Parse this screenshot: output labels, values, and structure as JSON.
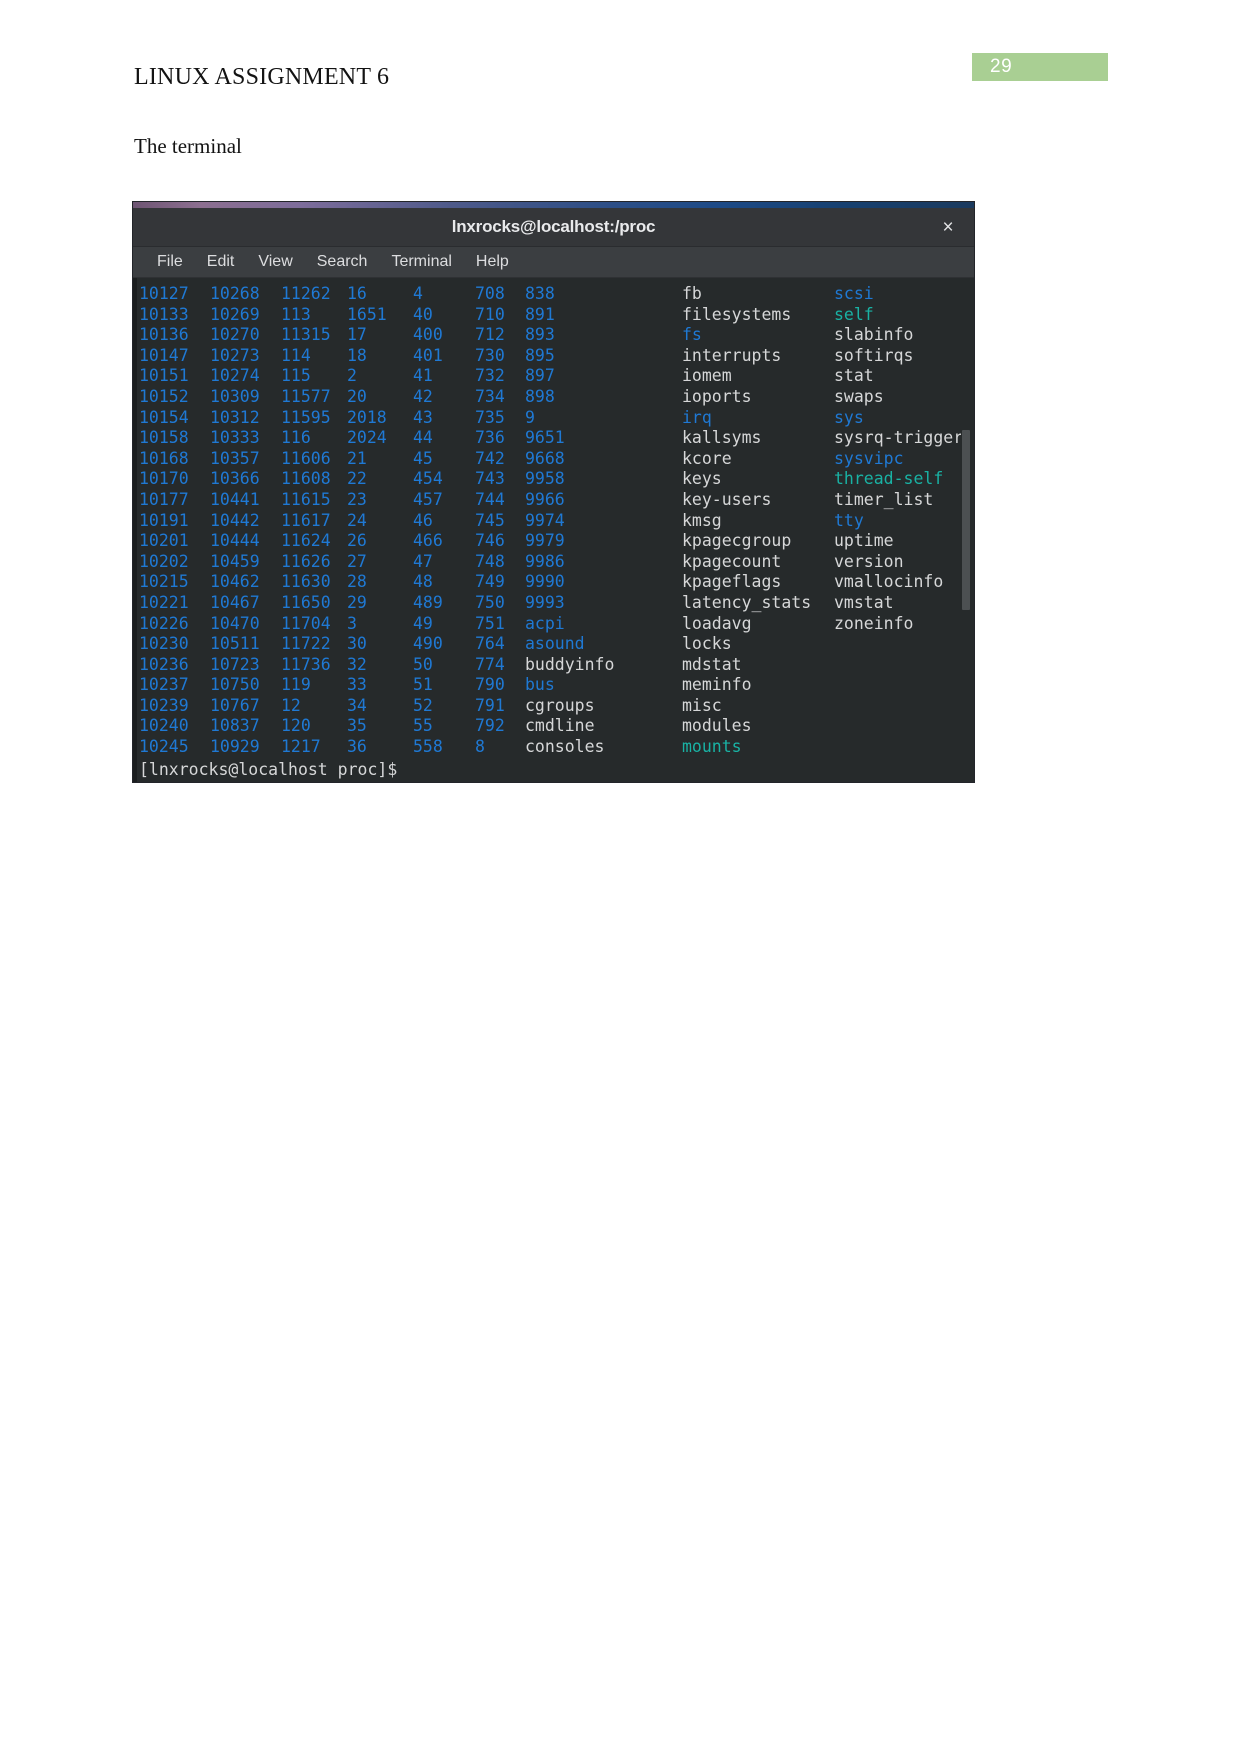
{
  "document": {
    "title": "LINUX ASSIGNMENT 6",
    "subtitle": "The terminal",
    "page_number": "29",
    "badge_color": "#a9cf93"
  },
  "terminal": {
    "window_title": "lnxrocks@localhost:/proc",
    "close_icon": "×",
    "menu": [
      {
        "label": "File"
      },
      {
        "label": "Edit"
      },
      {
        "label": "View"
      },
      {
        "label": "Search"
      },
      {
        "label": "Terminal"
      },
      {
        "label": "Help"
      }
    ],
    "prompt": "[lnxrocks@localhost proc]$",
    "colors": {
      "directory": "#1f79d4",
      "file": "#d6d7d8",
      "symlink": "#19b2a4",
      "background": "#262a2b",
      "titlebar": "#343639",
      "menubar": "#3b3e41"
    },
    "listing_rows": [
      [
        {
          "t": "10127",
          "k": "dir"
        },
        {
          "t": "10268",
          "k": "dir"
        },
        {
          "t": "11262",
          "k": "dir"
        },
        {
          "t": "16",
          "k": "dir"
        },
        {
          "t": "4",
          "k": "dir"
        },
        {
          "t": "708",
          "k": "dir"
        },
        {
          "t": "838",
          "k": "dir"
        },
        {
          "t": "fb",
          "k": "file"
        },
        {
          "t": "scsi",
          "k": "dir"
        }
      ],
      [
        {
          "t": "10133",
          "k": "dir"
        },
        {
          "t": "10269",
          "k": "dir"
        },
        {
          "t": "113",
          "k": "dir"
        },
        {
          "t": "1651",
          "k": "dir"
        },
        {
          "t": "40",
          "k": "dir"
        },
        {
          "t": "710",
          "k": "dir"
        },
        {
          "t": "891",
          "k": "dir"
        },
        {
          "t": "filesystems",
          "k": "file"
        },
        {
          "t": "self",
          "k": "link"
        }
      ],
      [
        {
          "t": "10136",
          "k": "dir"
        },
        {
          "t": "10270",
          "k": "dir"
        },
        {
          "t": "11315",
          "k": "dir"
        },
        {
          "t": "17",
          "k": "dir"
        },
        {
          "t": "400",
          "k": "dir"
        },
        {
          "t": "712",
          "k": "dir"
        },
        {
          "t": "893",
          "k": "dir"
        },
        {
          "t": "fs",
          "k": "dir"
        },
        {
          "t": "slabinfo",
          "k": "file"
        }
      ],
      [
        {
          "t": "10147",
          "k": "dir"
        },
        {
          "t": "10273",
          "k": "dir"
        },
        {
          "t": "114",
          "k": "dir"
        },
        {
          "t": "18",
          "k": "dir"
        },
        {
          "t": "401",
          "k": "dir"
        },
        {
          "t": "730",
          "k": "dir"
        },
        {
          "t": "895",
          "k": "dir"
        },
        {
          "t": "interrupts",
          "k": "file"
        },
        {
          "t": "softirqs",
          "k": "file"
        }
      ],
      [
        {
          "t": "10151",
          "k": "dir"
        },
        {
          "t": "10274",
          "k": "dir"
        },
        {
          "t": "115",
          "k": "dir"
        },
        {
          "t": "2",
          "k": "dir"
        },
        {
          "t": "41",
          "k": "dir"
        },
        {
          "t": "732",
          "k": "dir"
        },
        {
          "t": "897",
          "k": "dir"
        },
        {
          "t": "iomem",
          "k": "file"
        },
        {
          "t": "stat",
          "k": "file"
        }
      ],
      [
        {
          "t": "10152",
          "k": "dir"
        },
        {
          "t": "10309",
          "k": "dir"
        },
        {
          "t": "11577",
          "k": "dir"
        },
        {
          "t": "20",
          "k": "dir"
        },
        {
          "t": "42",
          "k": "dir"
        },
        {
          "t": "734",
          "k": "dir"
        },
        {
          "t": "898",
          "k": "dir"
        },
        {
          "t": "ioports",
          "k": "file"
        },
        {
          "t": "swaps",
          "k": "file"
        }
      ],
      [
        {
          "t": "10154",
          "k": "dir"
        },
        {
          "t": "10312",
          "k": "dir"
        },
        {
          "t": "11595",
          "k": "dir"
        },
        {
          "t": "2018",
          "k": "dir"
        },
        {
          "t": "43",
          "k": "dir"
        },
        {
          "t": "735",
          "k": "dir"
        },
        {
          "t": "9",
          "k": "dir"
        },
        {
          "t": "irq",
          "k": "dir"
        },
        {
          "t": "sys",
          "k": "dir"
        }
      ],
      [
        {
          "t": "10158",
          "k": "dir"
        },
        {
          "t": "10333",
          "k": "dir"
        },
        {
          "t": "116",
          "k": "dir"
        },
        {
          "t": "2024",
          "k": "dir"
        },
        {
          "t": "44",
          "k": "dir"
        },
        {
          "t": "736",
          "k": "dir"
        },
        {
          "t": "9651",
          "k": "dir"
        },
        {
          "t": "kallsyms",
          "k": "file"
        },
        {
          "t": "sysrq-trigger",
          "k": "file"
        }
      ],
      [
        {
          "t": "10168",
          "k": "dir"
        },
        {
          "t": "10357",
          "k": "dir"
        },
        {
          "t": "11606",
          "k": "dir"
        },
        {
          "t": "21",
          "k": "dir"
        },
        {
          "t": "45",
          "k": "dir"
        },
        {
          "t": "742",
          "k": "dir"
        },
        {
          "t": "9668",
          "k": "dir"
        },
        {
          "t": "kcore",
          "k": "file"
        },
        {
          "t": "sysvipc",
          "k": "dir"
        }
      ],
      [
        {
          "t": "10170",
          "k": "dir"
        },
        {
          "t": "10366",
          "k": "dir"
        },
        {
          "t": "11608",
          "k": "dir"
        },
        {
          "t": "22",
          "k": "dir"
        },
        {
          "t": "454",
          "k": "dir"
        },
        {
          "t": "743",
          "k": "dir"
        },
        {
          "t": "9958",
          "k": "dir"
        },
        {
          "t": "keys",
          "k": "file"
        },
        {
          "t": "thread-self",
          "k": "link"
        }
      ],
      [
        {
          "t": "10177",
          "k": "dir"
        },
        {
          "t": "10441",
          "k": "dir"
        },
        {
          "t": "11615",
          "k": "dir"
        },
        {
          "t": "23",
          "k": "dir"
        },
        {
          "t": "457",
          "k": "dir"
        },
        {
          "t": "744",
          "k": "dir"
        },
        {
          "t": "9966",
          "k": "dir"
        },
        {
          "t": "key-users",
          "k": "file"
        },
        {
          "t": "timer_list",
          "k": "file"
        }
      ],
      [
        {
          "t": "10191",
          "k": "dir"
        },
        {
          "t": "10442",
          "k": "dir"
        },
        {
          "t": "11617",
          "k": "dir"
        },
        {
          "t": "24",
          "k": "dir"
        },
        {
          "t": "46",
          "k": "dir"
        },
        {
          "t": "745",
          "k": "dir"
        },
        {
          "t": "9974",
          "k": "dir"
        },
        {
          "t": "kmsg",
          "k": "file"
        },
        {
          "t": "tty",
          "k": "dir"
        }
      ],
      [
        {
          "t": "10201",
          "k": "dir"
        },
        {
          "t": "10444",
          "k": "dir"
        },
        {
          "t": "11624",
          "k": "dir"
        },
        {
          "t": "26",
          "k": "dir"
        },
        {
          "t": "466",
          "k": "dir"
        },
        {
          "t": "746",
          "k": "dir"
        },
        {
          "t": "9979",
          "k": "dir"
        },
        {
          "t": "kpagecgroup",
          "k": "file"
        },
        {
          "t": "uptime",
          "k": "file"
        }
      ],
      [
        {
          "t": "10202",
          "k": "dir"
        },
        {
          "t": "10459",
          "k": "dir"
        },
        {
          "t": "11626",
          "k": "dir"
        },
        {
          "t": "27",
          "k": "dir"
        },
        {
          "t": "47",
          "k": "dir"
        },
        {
          "t": "748",
          "k": "dir"
        },
        {
          "t": "9986",
          "k": "dir"
        },
        {
          "t": "kpagecount",
          "k": "file"
        },
        {
          "t": "version",
          "k": "file"
        }
      ],
      [
        {
          "t": "10215",
          "k": "dir"
        },
        {
          "t": "10462",
          "k": "dir"
        },
        {
          "t": "11630",
          "k": "dir"
        },
        {
          "t": "28",
          "k": "dir"
        },
        {
          "t": "48",
          "k": "dir"
        },
        {
          "t": "749",
          "k": "dir"
        },
        {
          "t": "9990",
          "k": "dir"
        },
        {
          "t": "kpageflags",
          "k": "file"
        },
        {
          "t": "vmallocinfo",
          "k": "file"
        }
      ],
      [
        {
          "t": "10221",
          "k": "dir"
        },
        {
          "t": "10467",
          "k": "dir"
        },
        {
          "t": "11650",
          "k": "dir"
        },
        {
          "t": "29",
          "k": "dir"
        },
        {
          "t": "489",
          "k": "dir"
        },
        {
          "t": "750",
          "k": "dir"
        },
        {
          "t": "9993",
          "k": "dir"
        },
        {
          "t": "latency_stats",
          "k": "file"
        },
        {
          "t": "vmstat",
          "k": "file"
        }
      ],
      [
        {
          "t": "10226",
          "k": "dir"
        },
        {
          "t": "10470",
          "k": "dir"
        },
        {
          "t": "11704",
          "k": "dir"
        },
        {
          "t": "3",
          "k": "dir"
        },
        {
          "t": "49",
          "k": "dir"
        },
        {
          "t": "751",
          "k": "dir"
        },
        {
          "t": "acpi",
          "k": "dir"
        },
        {
          "t": "loadavg",
          "k": "file"
        },
        {
          "t": "zoneinfo",
          "k": "file"
        }
      ],
      [
        {
          "t": "10230",
          "k": "dir"
        },
        {
          "t": "10511",
          "k": "dir"
        },
        {
          "t": "11722",
          "k": "dir"
        },
        {
          "t": "30",
          "k": "dir"
        },
        {
          "t": "490",
          "k": "dir"
        },
        {
          "t": "764",
          "k": "dir"
        },
        {
          "t": "asound",
          "k": "dir"
        },
        {
          "t": "locks",
          "k": "file"
        },
        {
          "t": "",
          "k": "file"
        }
      ],
      [
        {
          "t": "10236",
          "k": "dir"
        },
        {
          "t": "10723",
          "k": "dir"
        },
        {
          "t": "11736",
          "k": "dir"
        },
        {
          "t": "32",
          "k": "dir"
        },
        {
          "t": "50",
          "k": "dir"
        },
        {
          "t": "774",
          "k": "dir"
        },
        {
          "t": "buddyinfo",
          "k": "file"
        },
        {
          "t": "mdstat",
          "k": "file"
        },
        {
          "t": "",
          "k": "file"
        }
      ],
      [
        {
          "t": "10237",
          "k": "dir"
        },
        {
          "t": "10750",
          "k": "dir"
        },
        {
          "t": "119",
          "k": "dir"
        },
        {
          "t": "33",
          "k": "dir"
        },
        {
          "t": "51",
          "k": "dir"
        },
        {
          "t": "790",
          "k": "dir"
        },
        {
          "t": "bus",
          "k": "dir"
        },
        {
          "t": "meminfo",
          "k": "file"
        },
        {
          "t": "",
          "k": "file"
        }
      ],
      [
        {
          "t": "10239",
          "k": "dir"
        },
        {
          "t": "10767",
          "k": "dir"
        },
        {
          "t": "12",
          "k": "dir"
        },
        {
          "t": "34",
          "k": "dir"
        },
        {
          "t": "52",
          "k": "dir"
        },
        {
          "t": "791",
          "k": "dir"
        },
        {
          "t": "cgroups",
          "k": "file"
        },
        {
          "t": "misc",
          "k": "file"
        },
        {
          "t": "",
          "k": "file"
        }
      ],
      [
        {
          "t": "10240",
          "k": "dir"
        },
        {
          "t": "10837",
          "k": "dir"
        },
        {
          "t": "120",
          "k": "dir"
        },
        {
          "t": "35",
          "k": "dir"
        },
        {
          "t": "55",
          "k": "dir"
        },
        {
          "t": "792",
          "k": "dir"
        },
        {
          "t": "cmdline",
          "k": "file"
        },
        {
          "t": "modules",
          "k": "file"
        },
        {
          "t": "",
          "k": "file"
        }
      ],
      [
        {
          "t": "10245",
          "k": "dir"
        },
        {
          "t": "10929",
          "k": "dir"
        },
        {
          "t": "1217",
          "k": "dir"
        },
        {
          "t": "36",
          "k": "dir"
        },
        {
          "t": "558",
          "k": "dir"
        },
        {
          "t": "8",
          "k": "dir"
        },
        {
          "t": "consoles",
          "k": "file"
        },
        {
          "t": "mounts",
          "k": "link"
        },
        {
          "t": "",
          "k": "file"
        }
      ]
    ]
  }
}
